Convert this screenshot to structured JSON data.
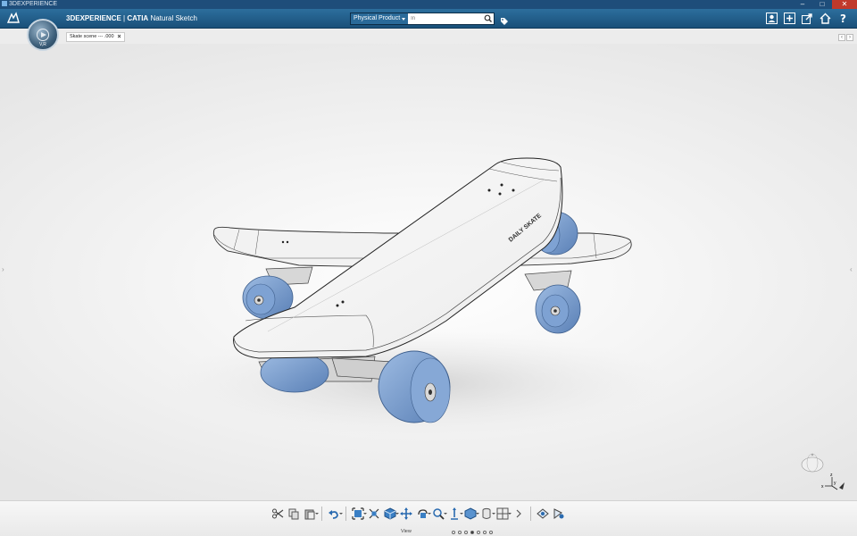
{
  "window": {
    "title": "3DEXPERIENCE",
    "controls": [
      "–",
      "□",
      "✕"
    ]
  },
  "topbar": {
    "brand": "3DEXPERIENCE",
    "separator": "|",
    "app_brand": "CATIA",
    "app_name": "Natural Sketch",
    "compass_label": "V,R",
    "search": {
      "scope": "Physical Product",
      "placeholder": "In",
      "value": ""
    },
    "right_icons": [
      "user-icon",
      "add-icon",
      "share-icon",
      "home-icon",
      "help-icon"
    ]
  },
  "tabs": [
    {
      "label": "Skate scene --- .000",
      "close": "×"
    }
  ],
  "tab_nav": {
    "prev": "‹",
    "next": "›"
  },
  "viewport": {
    "left_arrow": "›",
    "right_arrow": "‹",
    "deck_print": "DAILY SKATE",
    "axes": {
      "x": "x",
      "y": "y",
      "z": "z"
    },
    "colors": {
      "deck": "#f5f5f5",
      "wheel": "#7a9fd0",
      "wheel_dark": "#4f75ac",
      "truck": "#c8c8c8"
    }
  },
  "actionbar": {
    "section": "View",
    "tools": [
      "cut-icon",
      "copy-icon",
      "paste-icon",
      "undo-icon",
      "fit-all-icon",
      "zoom-area-icon",
      "view-cube-icon",
      "pan-icon",
      "rotate-icon",
      "zoom-icon",
      "normal-view-icon",
      "render-style-icon",
      "cylinder-icon",
      "multi-view-icon",
      "more-icon",
      "hide-show-icon",
      "swap-visible-icon"
    ],
    "pages": 7,
    "active_page": 4
  }
}
